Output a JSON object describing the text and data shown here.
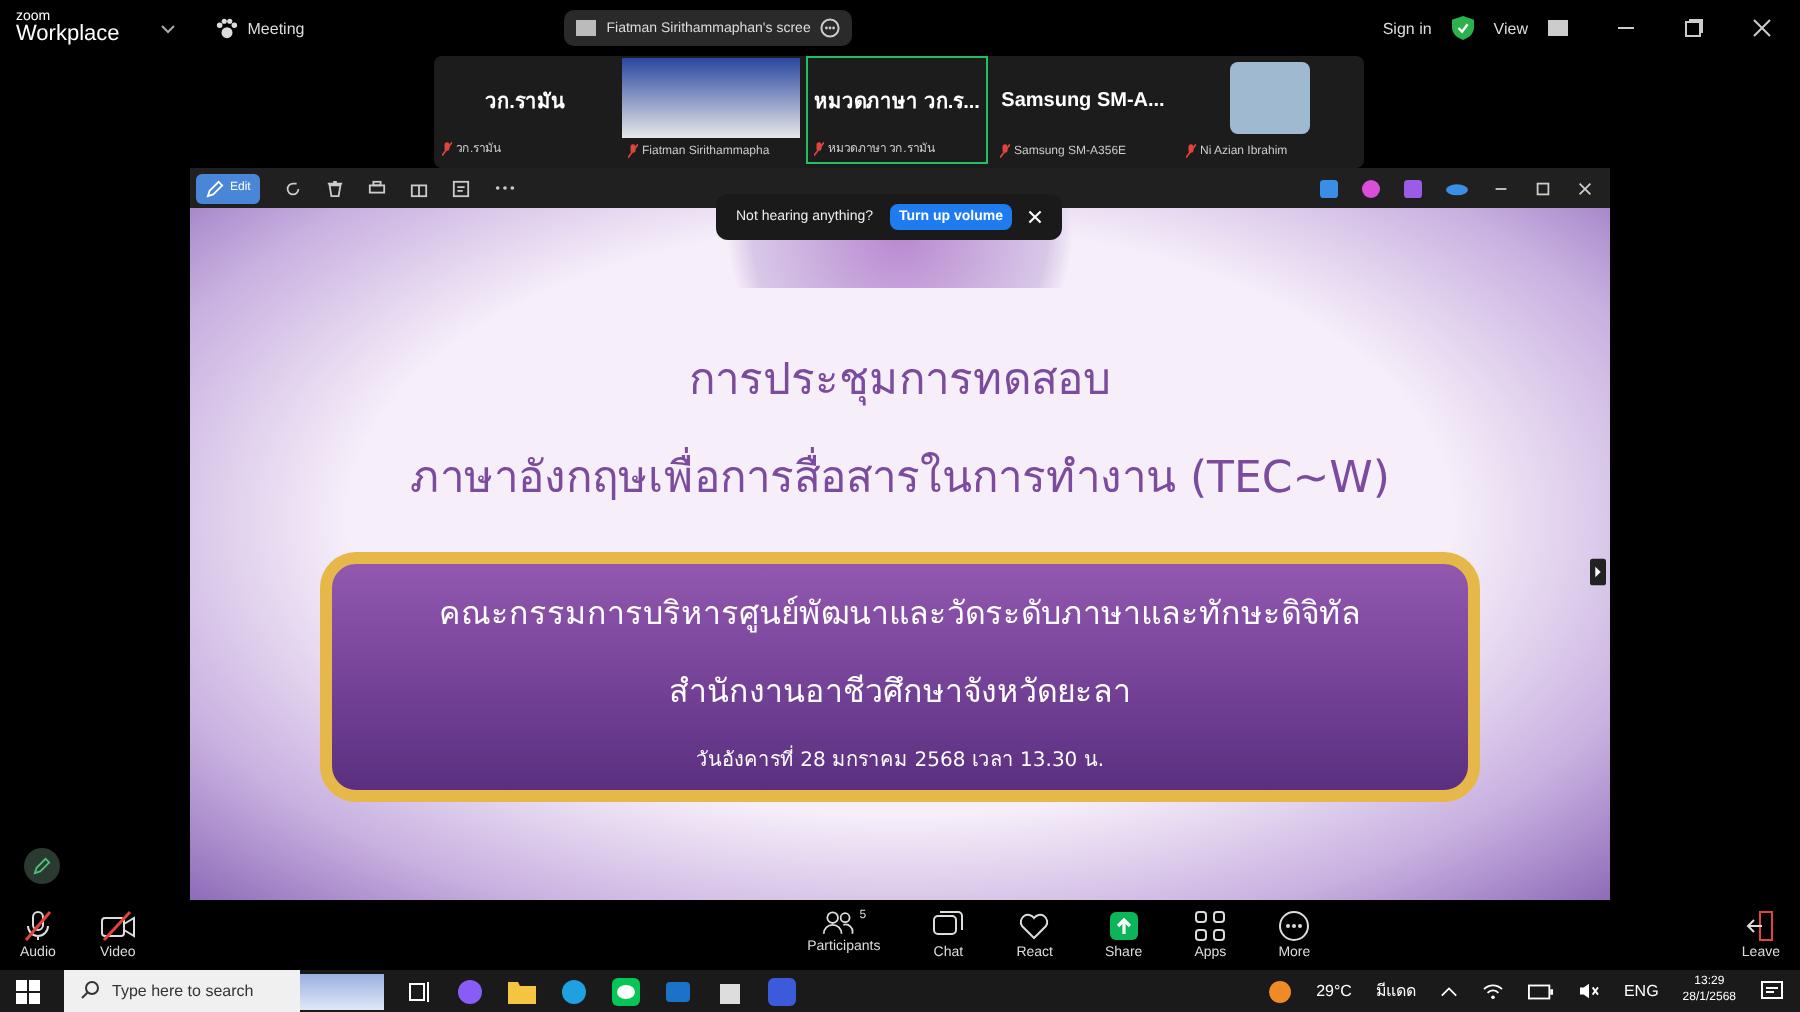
{
  "app": {
    "logo_small": "zoom",
    "logo_large": "Workplace",
    "meeting_label": "Meeting",
    "share_label": "Fiatman Sirithammaphan's scree",
    "sign_in": "Sign in",
    "view": "View"
  },
  "participants": [
    {
      "kind": "name",
      "title": "วก.รามัน",
      "label": "วก.รามัน",
      "speaking": false
    },
    {
      "kind": "video",
      "label": "Fiatman Sirithammapha",
      "speaking": false
    },
    {
      "kind": "name",
      "title": "หมวดภาษา วก.ร...",
      "label": "หมวดภาษา วก.รามัน",
      "speaking": true
    },
    {
      "kind": "name",
      "title": "Samsung SM-A...",
      "label": "Samsung SM-A356E",
      "speaking": false
    },
    {
      "kind": "photo",
      "label": "Ni Azian Ibrahim",
      "speaking": false
    }
  ],
  "shared_window": {
    "edit": "Edit",
    "notice": "Not hearing anything?",
    "notice_button": "Turn up volume"
  },
  "slide": {
    "title": "การประชุมการทดสอบ",
    "subtitle": "ภาษาอังกฤษเพื่อการสื่อสารในการทำงาน  (TEC~W)",
    "org": "คณะกรรมการบริหารศูนย์พัฒนาและวัดระดับภาษาและทักษะดิจิทัล",
    "office": "สำนักงานอาชีวศึกษาจังหวัดยะลา",
    "date": "วันอังคารที่  28  มกราคม  2568  เวลา  13.30  น."
  },
  "controls": [
    {
      "kind": "audio",
      "label": "Audio",
      "muted": true
    },
    {
      "kind": "video",
      "label": "Video",
      "muted": true
    },
    {
      "kind": "participants",
      "label": "Participants",
      "count": "5"
    },
    {
      "kind": "chat",
      "label": "Chat"
    },
    {
      "kind": "react",
      "label": "React"
    },
    {
      "kind": "share",
      "label": "Share"
    },
    {
      "kind": "apps",
      "label": "Apps"
    },
    {
      "kind": "more",
      "label": "More"
    },
    {
      "kind": "leave",
      "label": "Leave"
    }
  ],
  "taskbar": {
    "search_placeholder": "Type here to search",
    "temperature": "29°C",
    "weather": "มีแดด",
    "language": "ENG",
    "time": "13:29",
    "date": "28/1/2568"
  }
}
